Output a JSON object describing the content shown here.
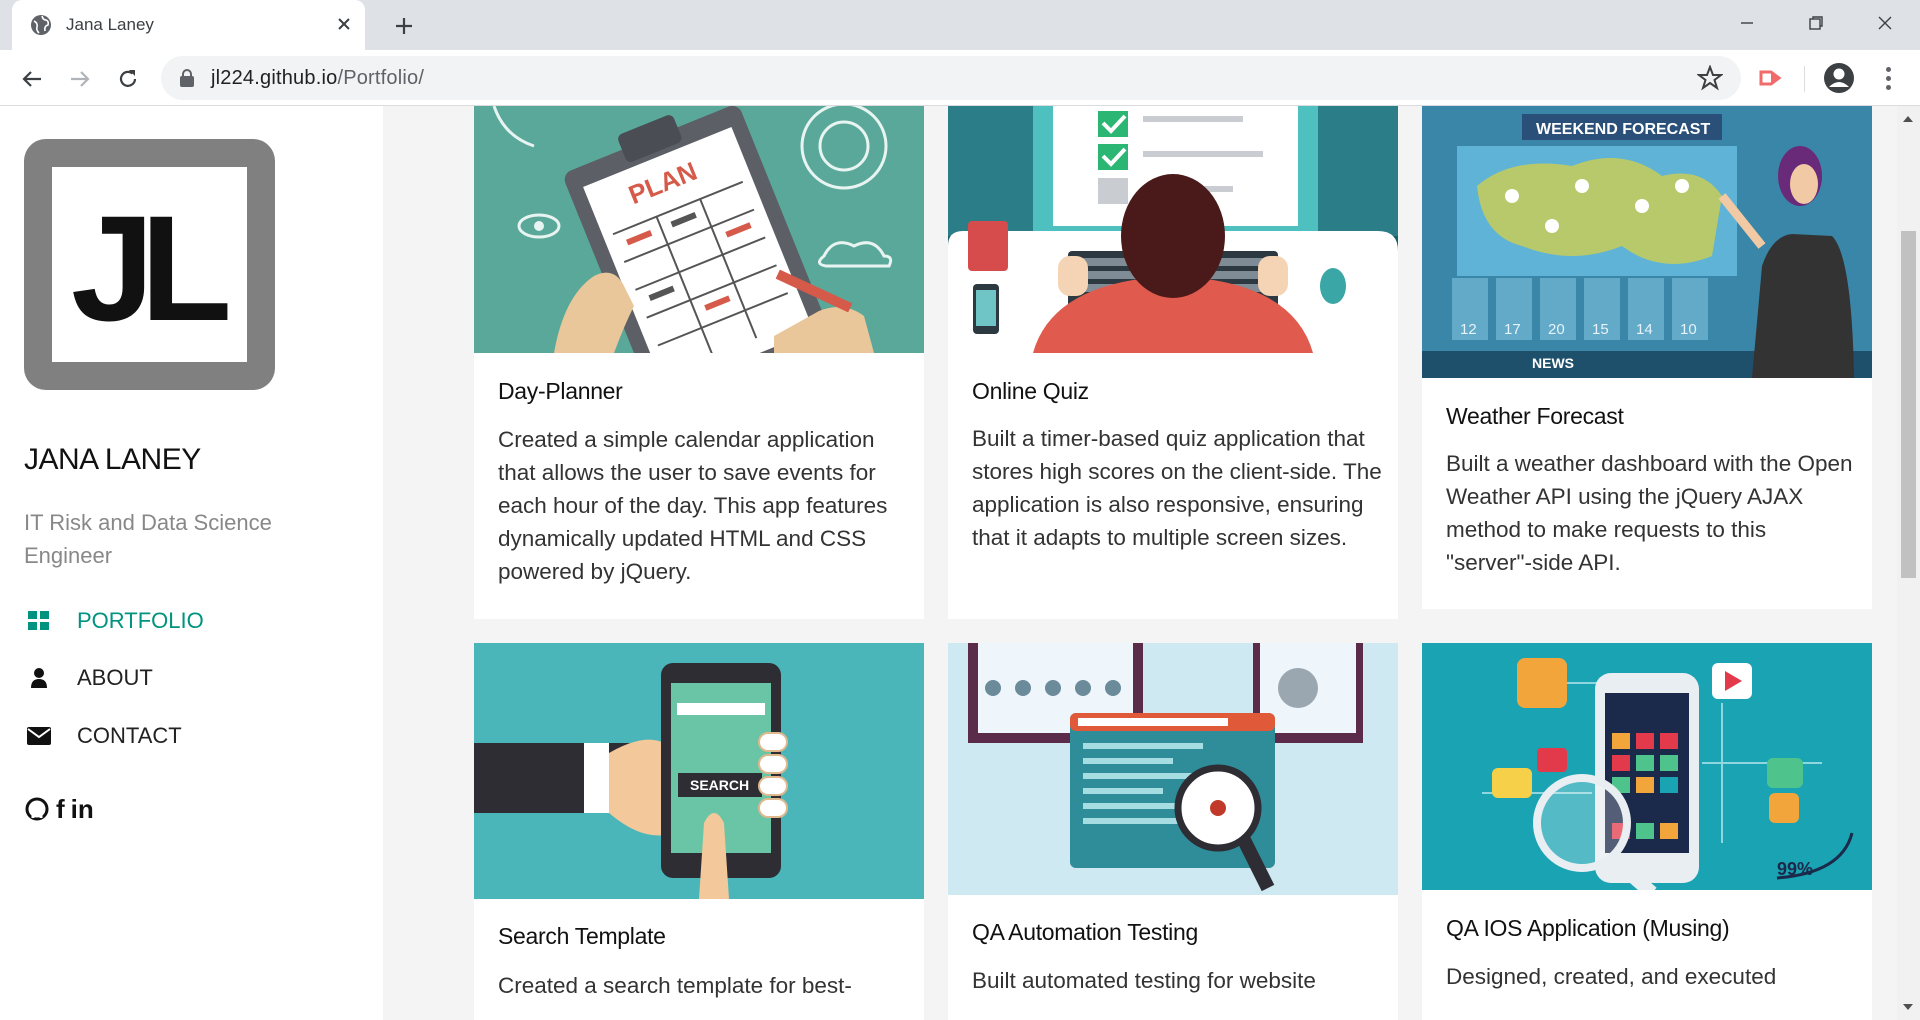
{
  "browser": {
    "tab_title": "Jana Laney",
    "url_host": "jl224.github.io",
    "url_path": "/Portfolio/"
  },
  "sidebar": {
    "logo_text": "JL",
    "name": "JANA LANEY",
    "role": "IT Risk and Data Science Engineer",
    "nav": [
      {
        "label": "PORTFOLIO",
        "icon": "grid-icon",
        "active": true
      },
      {
        "label": "ABOUT",
        "icon": "user-icon",
        "active": false
      },
      {
        "label": "CONTACT",
        "icon": "envelope-icon",
        "active": false
      }
    ],
    "socials": {
      "github": "github-icon",
      "facebook": "f",
      "linkedin": "in"
    },
    "accent": "#00937f"
  },
  "projects": [
    {
      "title": "Day-Planner",
      "description": "Created a simple calendar application that allows the user to save events for each hour of the day. This app features dynamically updated HTML and CSS powered by jQuery."
    },
    {
      "title": "Online Quiz",
      "description": "Built a timer-based quiz application that stores high scores on the client-side. The application is also responsive, ensuring that it adapts to multiple screen sizes."
    },
    {
      "title": "Weather Forecast",
      "description": "Built a weather dashboard with the Open Weather API using the jQuery AJAX method to make requests to this \"server\"-side API.",
      "image_text": {
        "banner": "WEEKEND FORECAST",
        "temps": [
          "12",
          "17",
          "20",
          "15",
          "14",
          "10"
        ],
        "news": "NEWS"
      }
    },
    {
      "title": "Search Template",
      "description": "Created a search template for best-",
      "image_text": {
        "button": "SEARCH"
      }
    },
    {
      "title": "QA Automation Testing",
      "description": "Built automated testing for website"
    },
    {
      "title": "QA IOS Application (Musing)",
      "description": "Designed, created, and executed",
      "image_text": {
        "percent": "99%"
      }
    }
  ]
}
